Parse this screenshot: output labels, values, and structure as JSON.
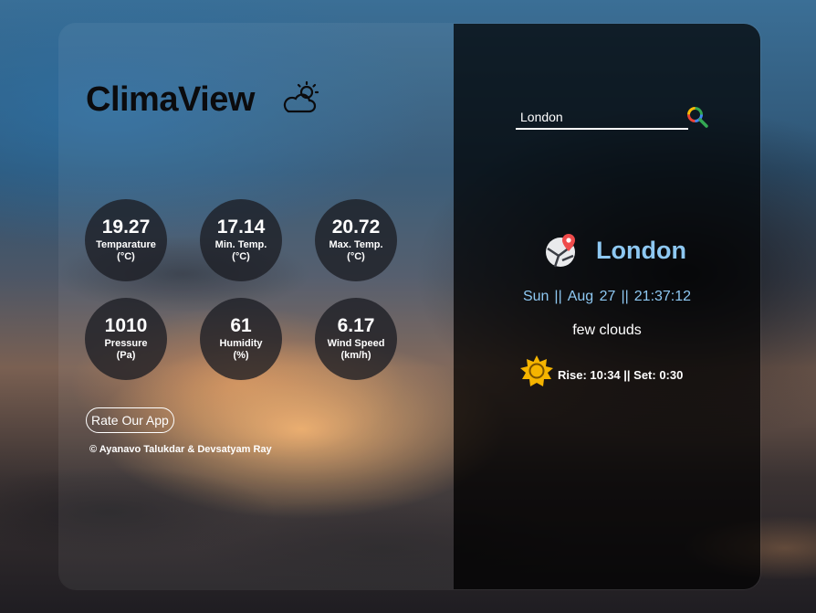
{
  "app": {
    "title": "ClimaView",
    "weather_icon": "partly-cloudy-icon"
  },
  "stats": [
    {
      "value": "19.27",
      "label": "Temparature",
      "unit": "(°C)"
    },
    {
      "value": "17.14",
      "label": "Min. Temp.",
      "unit": "(°C)"
    },
    {
      "value": "20.72",
      "label": "Max. Temp.",
      "unit": "(°C)"
    },
    {
      "value": "1010",
      "label": "Pressure",
      "unit": "(Pa)"
    },
    {
      "value": "61",
      "label": "Humidity",
      "unit": "(%)"
    },
    {
      "value": "6.17",
      "label": "Wind Speed",
      "unit": "(km/h)"
    }
  ],
  "rate_button": "Rate Our App",
  "copyright": "© Ayanavo Talukdar & Devsatyam Ray",
  "search": {
    "value": "London",
    "icon": "search-icon"
  },
  "location": {
    "city": "London",
    "icon": "map-pin-icon",
    "day": "Sun",
    "date": "Aug 27",
    "time": "21:37:12",
    "separator": "||",
    "condition": "few clouds",
    "sun_icon": "sun-icon",
    "sun_times": "Rise: 10:34 || Set: 0:30"
  },
  "colors": {
    "accent": "#8ec8f2",
    "left_panel": "#ffffff0f",
    "right_panel": "#000000b8",
    "stat_bubble": "#1c1e24c7",
    "sun": "#f5b400"
  }
}
